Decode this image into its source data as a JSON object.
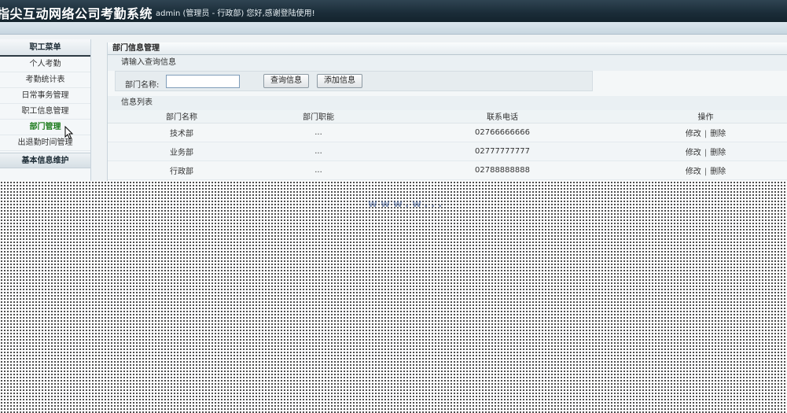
{
  "header": {
    "title": "指尖互动网络公司考勤系统",
    "welcome": "admin (管理员 - 行政部) 您好,感谢登陆使用!"
  },
  "sidebar": {
    "heading": "职工菜单",
    "items": [
      {
        "label": "个人考勤",
        "active": false
      },
      {
        "label": "考勤统计表",
        "active": false
      },
      {
        "label": "日常事务管理",
        "active": false
      },
      {
        "label": "职工信息管理",
        "active": false
      },
      {
        "label": "部门管理",
        "active": true
      },
      {
        "label": "出退勤时间管理",
        "active": false
      }
    ],
    "footer": "基本信息维护"
  },
  "main": {
    "panel_title": "部门信息管理",
    "search_section": "请输入查询信息",
    "search": {
      "label": "部门名称:",
      "value": "",
      "placeholder": ""
    },
    "buttons": {
      "query": "查询信息",
      "add": "添加信息"
    },
    "list_section": "信息列表",
    "table": {
      "headers": [
        "部门名称",
        "部门职能",
        "联系电话",
        "操作"
      ],
      "rows": [
        {
          "name": "技术部",
          "duty": "...",
          "phone": "02766666666",
          "edit": "修改",
          "del": "删除"
        },
        {
          "name": "业务部",
          "duty": "...",
          "phone": "02777777777",
          "edit": "修改",
          "del": "删除"
        },
        {
          "name": "行政部",
          "duty": "...",
          "phone": "02788888888",
          "edit": "修改",
          "del": "删除"
        }
      ]
    }
  },
  "overlay": {
    "ghost_text": "www.w..."
  },
  "icons": {
    "cursor": "mouse-pointer-icon"
  },
  "colors": {
    "header_bg": "#1a2c38",
    "active_menu": "#1a7a1a",
    "menu_rule": "#2d3a43"
  }
}
